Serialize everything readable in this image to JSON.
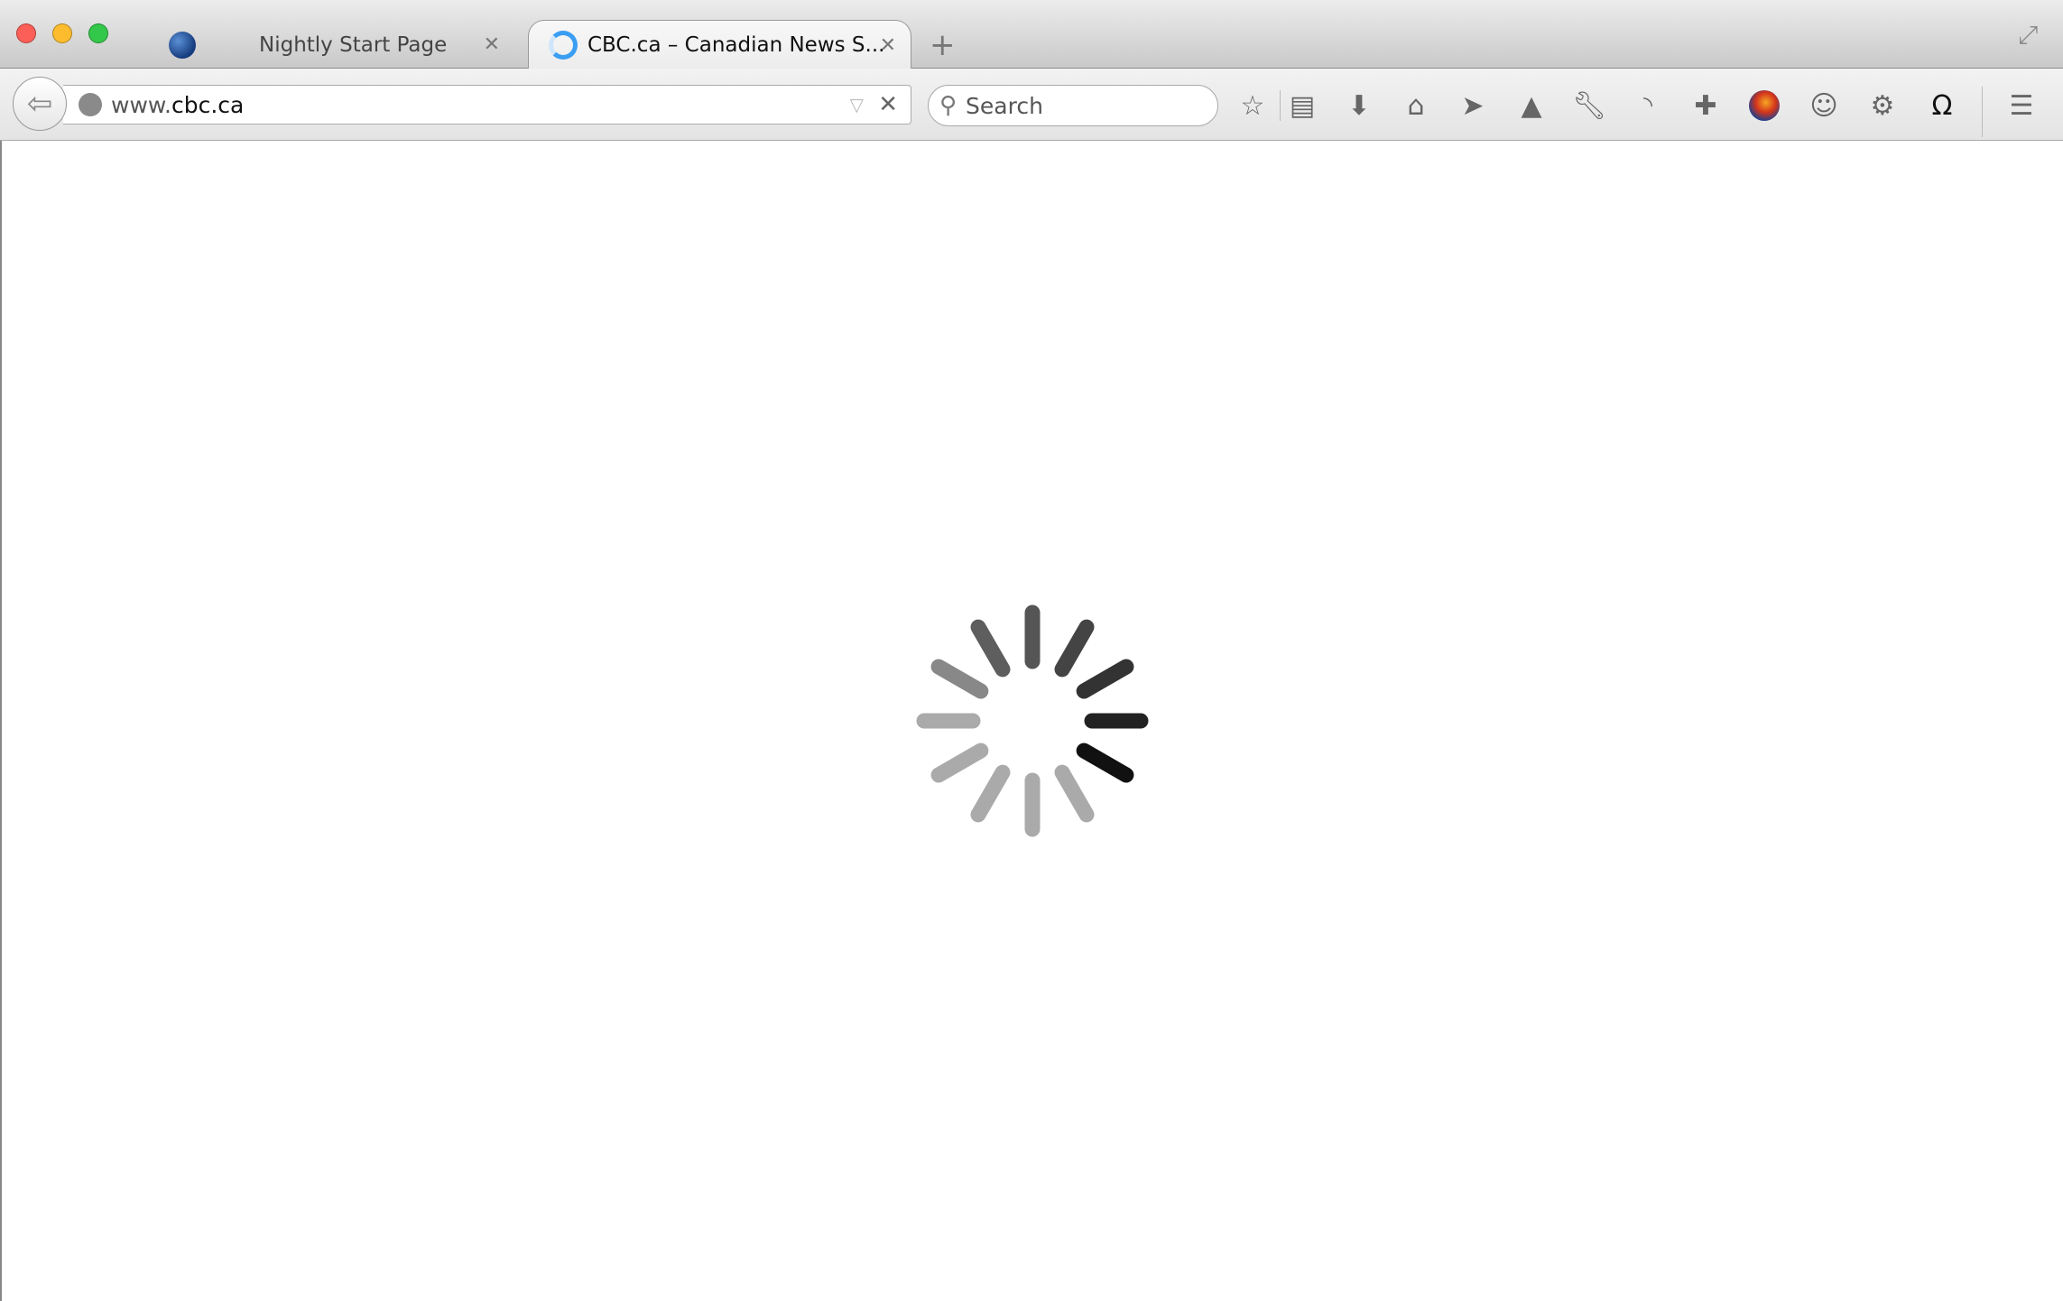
{
  "window": {
    "traffic_lights": {
      "close": "#fc5f57",
      "minimize": "#fdbc2e",
      "zoom": "#34c84a"
    }
  },
  "tabs": [
    {
      "label": "Nightly Start Page",
      "icon": "globe-icon",
      "active": false
    },
    {
      "label": "CBC.ca – Canadian News S...",
      "icon": "loading-throbber-icon",
      "active": true
    }
  ],
  "new_tab_label": "+",
  "navbar": {
    "url_prefix": "www.",
    "url_domain": "cbc.ca",
    "search_placeholder": "Search",
    "toolbar_icons": [
      "star-icon",
      "reading-list-icon",
      "download-icon",
      "home-icon",
      "paper-plane-icon",
      "rocket-icon",
      "wrench-icon",
      "rss-icon",
      "puzzle-icon",
      "firefox-icon",
      "chat-icon",
      "gear-icon",
      "pocket-icon",
      "menu-icon"
    ]
  },
  "content": {
    "state": "loading",
    "spinner_icon": "loading-spinner-icon"
  }
}
